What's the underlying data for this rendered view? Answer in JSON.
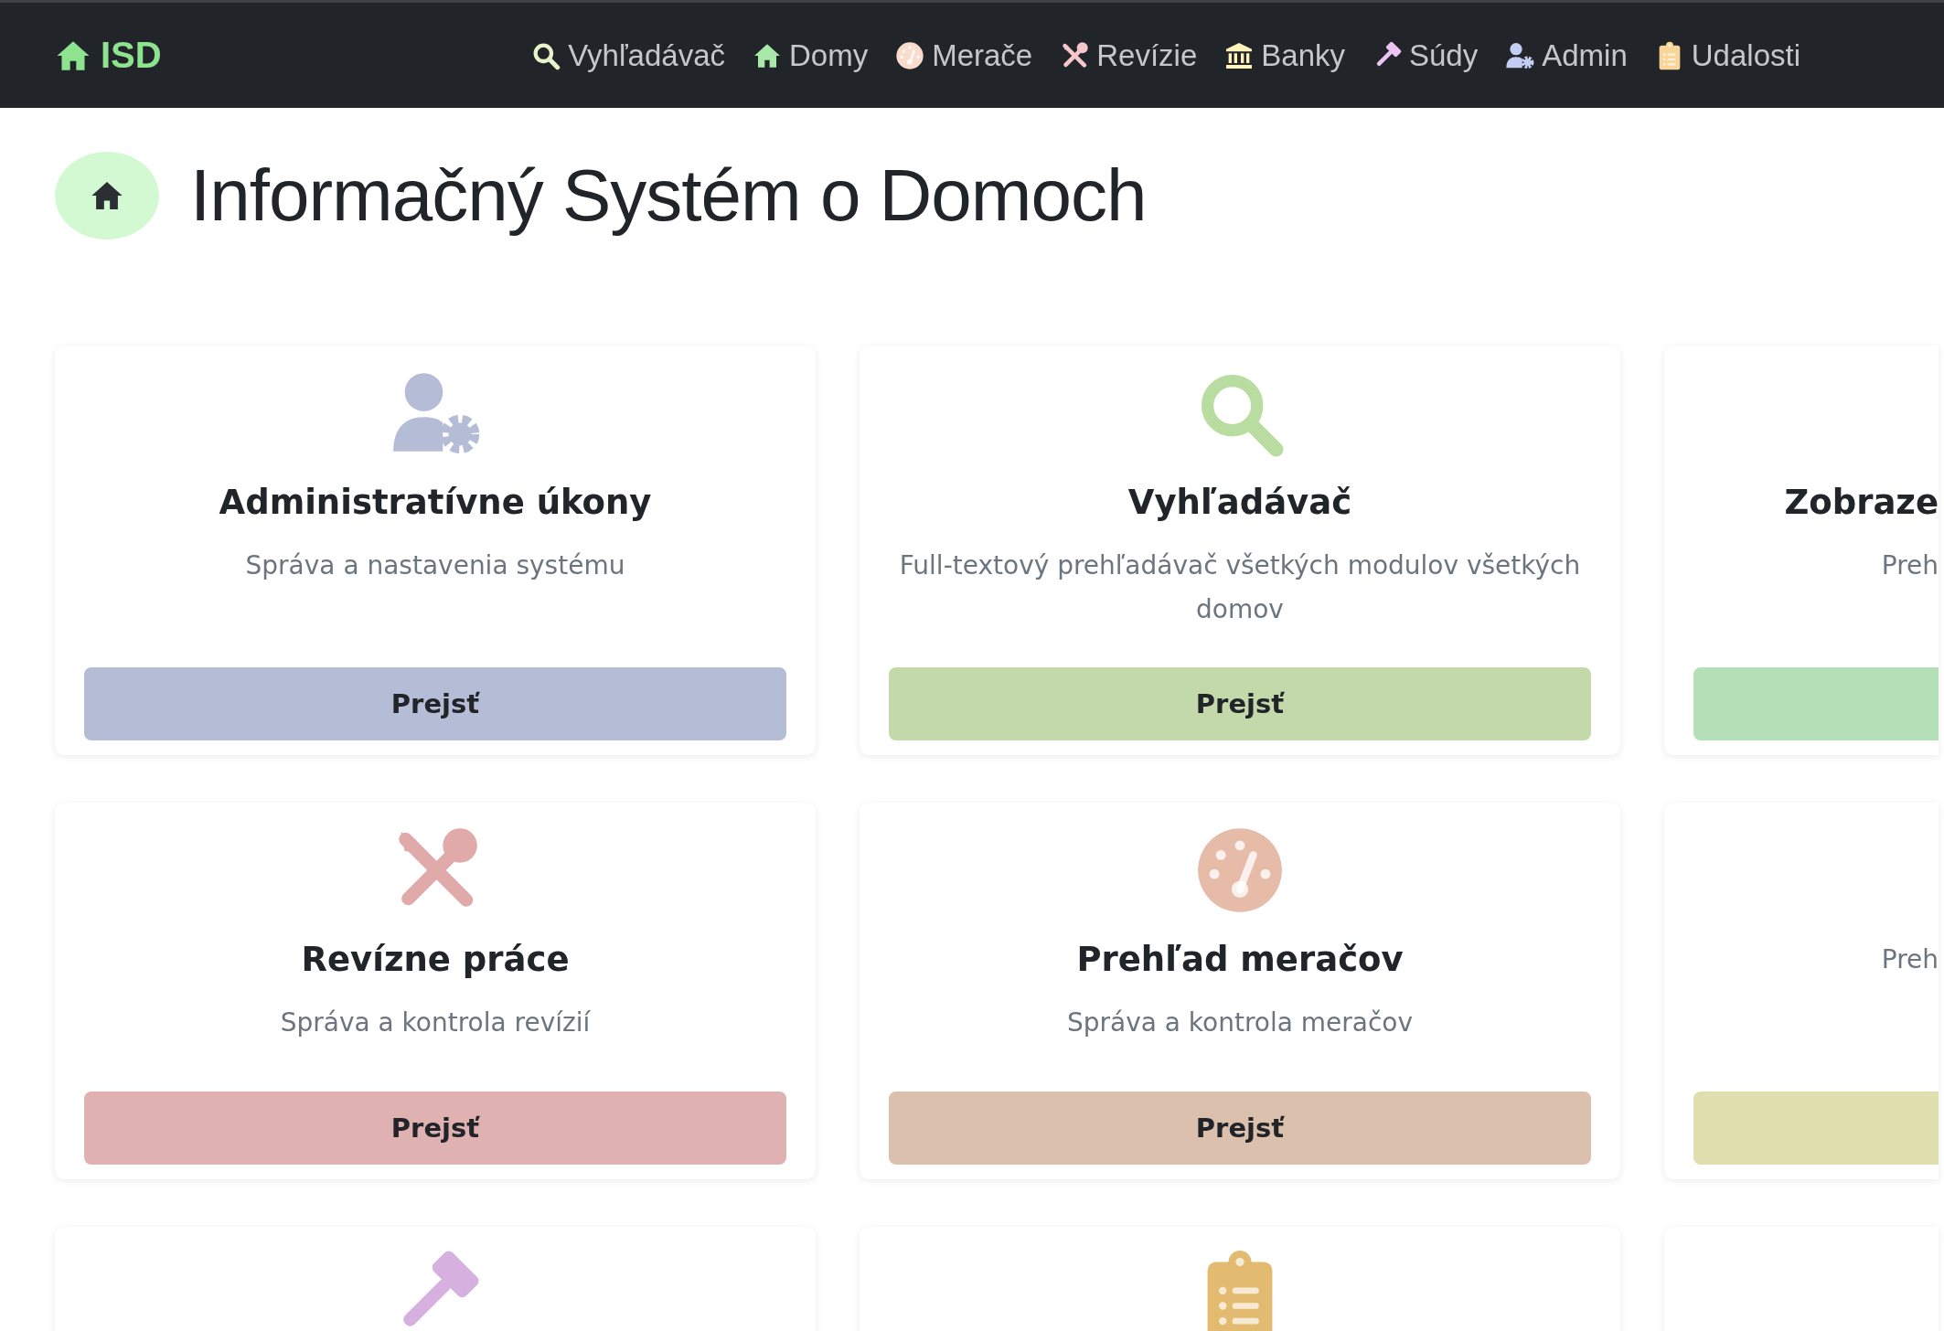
{
  "navbar": {
    "brand": "ISD",
    "items": [
      {
        "label": "Vyhľadávač"
      },
      {
        "label": "Domy"
      },
      {
        "label": "Merače"
      },
      {
        "label": "Revízie"
      },
      {
        "label": "Banky"
      },
      {
        "label": "Súdy"
      },
      {
        "label": "Admin"
      },
      {
        "label": "Udalosti"
      }
    ]
  },
  "heading": {
    "title": "Informačný Systém o Domoch"
  },
  "cards": [
    {
      "kind": "full",
      "title": "Administratívne úkony",
      "description": "Správa a nastavenia systému",
      "button": "Prejsť",
      "color": "#b5bcd5"
    },
    {
      "kind": "full",
      "title": "Vyhľadávač",
      "description": "Full-textový prehľadávač všetkých modulov všetkých domov",
      "button": "Prejsť",
      "color": "#c3d9aa"
    },
    {
      "kind": "partial",
      "title": "Zobraze",
      "description": "Preh",
      "color": "#b4dfb7"
    },
    {
      "kind": "full",
      "title": "Revízne práce",
      "description": "Správa a kontrola revízií",
      "button": "Prejsť",
      "color": "#e0b1b1"
    },
    {
      "kind": "full",
      "title": "Prehľad meračov",
      "description": "Správa a kontrola meračov",
      "button": "Prejsť",
      "color": "#dcc0ae"
    },
    {
      "kind": "partial",
      "description": "Preh",
      "color": "#dfdeae"
    },
    {
      "kind": "full"
    },
    {
      "kind": "full"
    },
    {
      "kind": "partial"
    }
  ]
}
